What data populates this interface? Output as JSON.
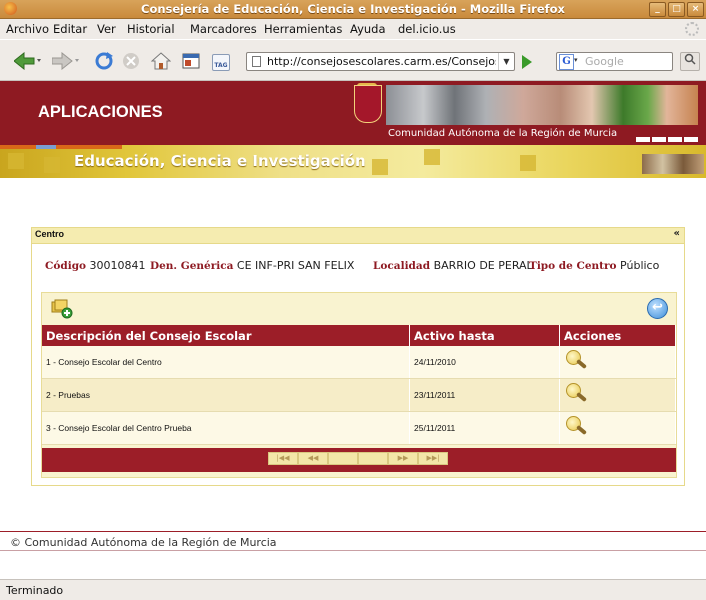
{
  "window": {
    "title": "Consejería de Educación, Ciencia e Investigación - Mozilla Firefox",
    "controls": [
      "_",
      "□",
      "×"
    ]
  },
  "menubar": {
    "items": [
      "Archivo",
      "Editar",
      "Ver",
      "Historial",
      "Marcadores",
      "Herramientas",
      "Ayuda",
      "del.icio.us"
    ]
  },
  "navbar": {
    "url": "http://consejosescolares.carm.es/ConsejosEscolares",
    "search_placeholder": "Google",
    "tag_label": "TAG"
  },
  "banner": {
    "apps_title": "APLICACIONES",
    "region_text": "Comunidad Autónoma de la Región de Murcia"
  },
  "section": {
    "title": "Educación, Ciencia e Investigación"
  },
  "centro": {
    "header": "Centro",
    "collapse_glyph": "«",
    "codigo_label": "Código",
    "codigo_value": "30010841",
    "den_label": "Den. Genérica",
    "den_value": "CE INF-PRI SAN FELIX",
    "localidad_label": "Localidad",
    "localidad_value": "BARRIO DE PERAL",
    "tipo_label": "Tipo de Centro",
    "tipo_value": "Público"
  },
  "table": {
    "columns": [
      "Descripción del Consejo Escolar",
      "Activo hasta",
      "Acciones"
    ],
    "rows": [
      {
        "descripcion": "1 - Consejo Escolar del Centro",
        "activo_hasta": "24/11/2010",
        "accion_icon": "search-icon"
      },
      {
        "descripcion": "2 - Pruebas",
        "activo_hasta": "23/11/2011",
        "accion_icon": "search-icon"
      },
      {
        "descripcion": "3 - Consejo Escolar del Centro Prueba",
        "activo_hasta": "25/11/2011",
        "accion_icon": "search-icon"
      }
    ]
  },
  "pager": {
    "buttons": [
      "|◀◀",
      "◀◀",
      "",
      "",
      "▶▶",
      "▶▶|"
    ]
  },
  "footer": {
    "text": "© Comunidad Autónoma de la Región de Murcia"
  },
  "statusbar": {
    "text": "Terminado"
  },
  "colors": {
    "brand_red": "#9c1e28",
    "banner_red": "#8e1a22",
    "gold": "#e1c63a",
    "panel_bg": "#f9f3d0"
  }
}
